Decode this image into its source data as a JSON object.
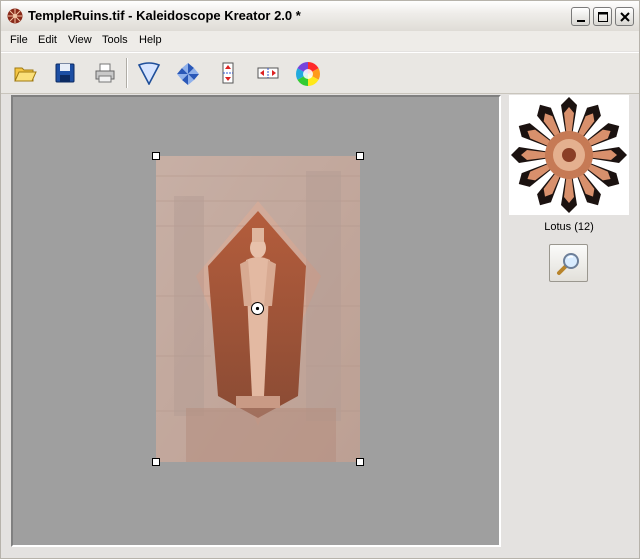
{
  "window": {
    "title": "TempleRuins.tif - Kaleidoscope Kreator 2.0 *",
    "controls": [
      "minimize-icon",
      "maximize-icon",
      "close-icon"
    ]
  },
  "menu": [
    "File",
    "Edit",
    "View",
    "Tools",
    "Help"
  ],
  "toolbar": {
    "tools": [
      "open-folder-icon",
      "save-disk-icon",
      "printer-icon",
      "wedge-shape-icon",
      "pinwheel-icon",
      "mirror-vertical-icon",
      "mirror-horizontal-icon",
      "color-wheel-icon"
    ]
  },
  "canvas": {
    "background": "#9f9f9f",
    "image_description_icon": "temple-statue-image"
  },
  "preview": {
    "caption": "Lotus (12)",
    "zoom_icon": "magnifier-icon"
  },
  "colors": {
    "canvas_bg": "#9f9f9f",
    "photo_tone": "#c28a72",
    "wedge_blue": "#1f4f9a"
  }
}
